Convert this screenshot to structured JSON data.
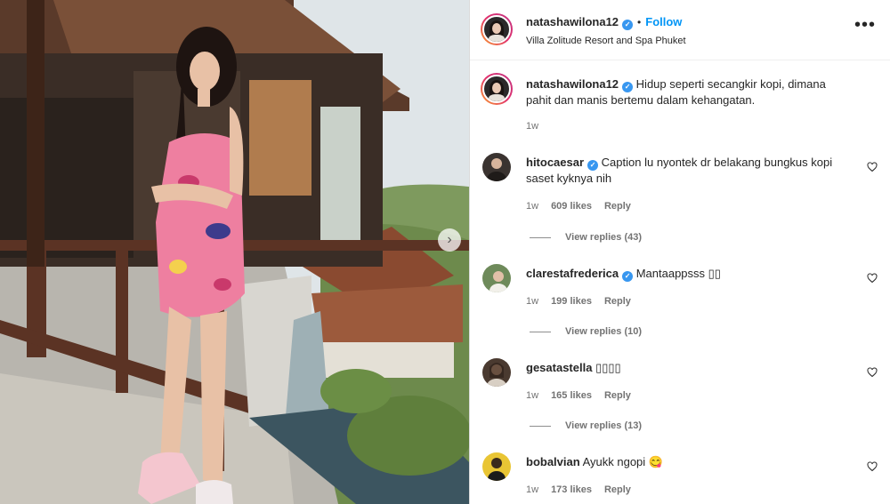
{
  "post": {
    "username": "natashawilona12",
    "follow_label": "Follow",
    "separator": "•",
    "location": "Villa Zolitude Resort and Spa Phuket",
    "more_label": "•••",
    "caption": "Hidup seperti secangkir kopi, dimana pahit dan manis bertemu dalam kehangatan.",
    "caption_time": "1w",
    "verified_mark": "✓"
  },
  "comments": [
    {
      "username": "hitocaesar",
      "verified": true,
      "text": "Caption lu nyontek dr belakang bungkus kopi saset kyknya nih",
      "time": "1w",
      "likes": "609 likes",
      "reply_label": "Reply",
      "view_replies": "View replies (43)"
    },
    {
      "username": "clarestafrederica",
      "verified": true,
      "text": "Mantaappsss ▯▯",
      "time": "1w",
      "likes": "199 likes",
      "reply_label": "Reply",
      "view_replies": "View replies (10)"
    },
    {
      "username": "gesatastella",
      "verified": false,
      "text": "▯▯▯▯",
      "time": "1w",
      "likes": "165 likes",
      "reply_label": "Reply",
      "view_replies": "View replies (13)"
    },
    {
      "username": "bobalvian",
      "verified": false,
      "text": "Ayukk ngopi 😋",
      "time": "1w",
      "likes": "173 likes",
      "reply_label": "Reply"
    }
  ],
  "icons": {
    "carousel_next": "chevron-right-icon",
    "more": "more-options-icon",
    "like": "heart-outline-icon",
    "verified": "verified-badge-icon"
  },
  "colors": {
    "accent": "#0095f6",
    "verified": "#3897f0",
    "muted": "#737373"
  }
}
